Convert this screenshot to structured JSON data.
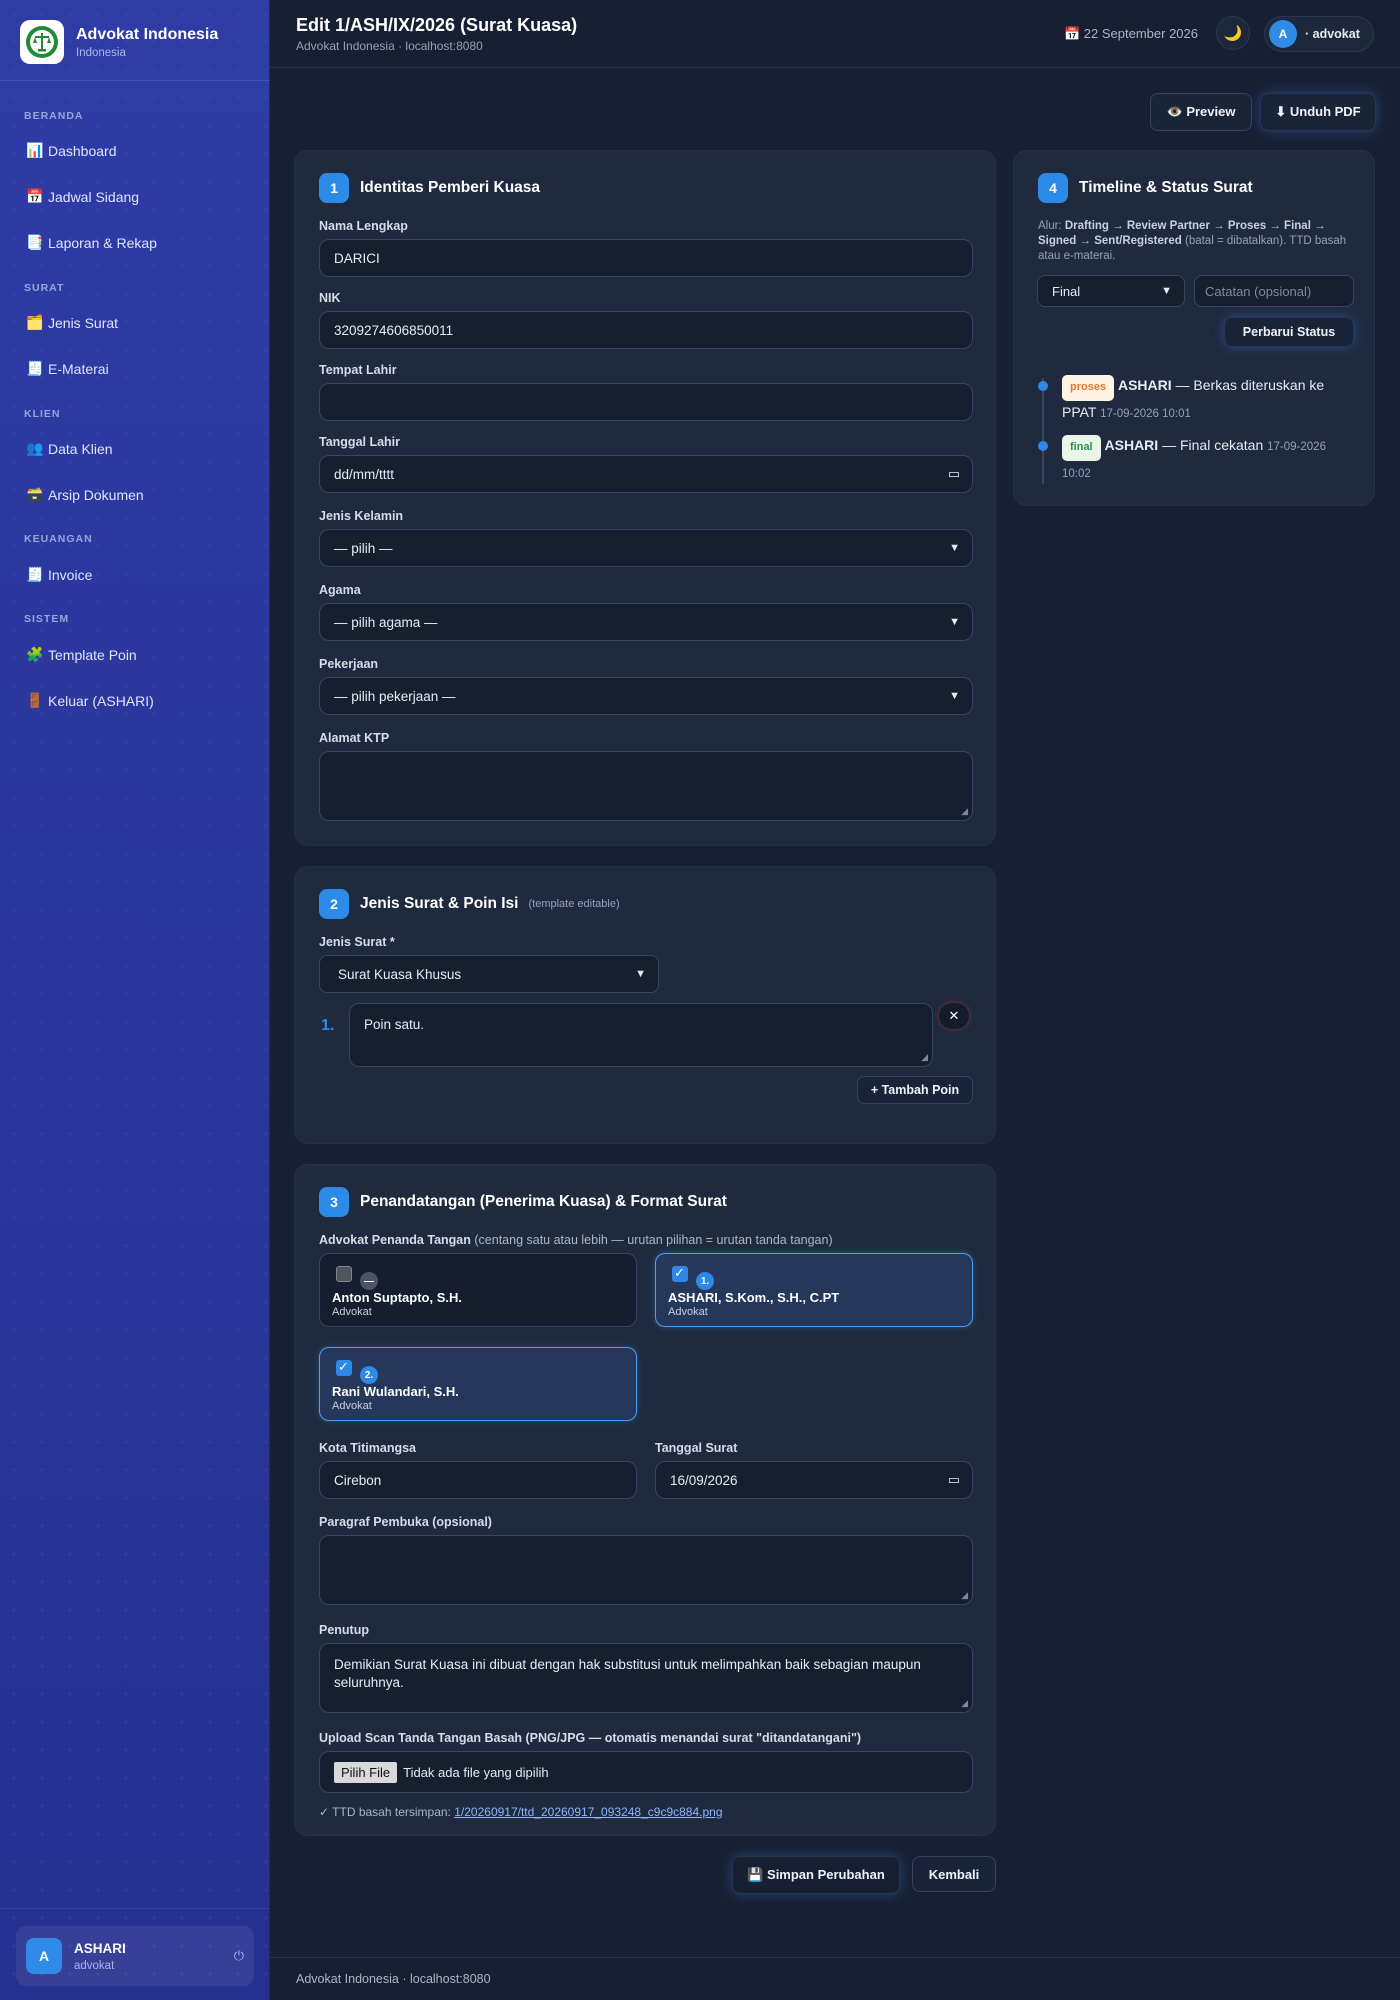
{
  "brand": {
    "name": "Advokat Indonesia",
    "subtitle": "Indonesia",
    "logo_icon": "scales-emblem-icon"
  },
  "sidebar": {
    "sections": [
      {
        "title": "BERANDA",
        "items": [
          {
            "icon": "📊",
            "label": "Dashboard"
          },
          {
            "icon": "📅",
            "label": "Jadwal Sidang"
          },
          {
            "icon": "📑",
            "label": "Laporan & Rekap"
          }
        ]
      },
      {
        "title": "SURAT",
        "items": [
          {
            "icon": "🗂️",
            "label": "Jenis Surat"
          },
          {
            "icon": "🧾",
            "label": "E-Materai"
          }
        ]
      },
      {
        "title": "KLIEN",
        "items": [
          {
            "icon": "👥",
            "label": "Data Klien"
          },
          {
            "icon": "🗃️",
            "label": "Arsip Dokumen"
          }
        ]
      },
      {
        "title": "KEUANGAN",
        "items": [
          {
            "icon": "🧾",
            "label": "Invoice"
          }
        ]
      },
      {
        "title": "SISTEM",
        "items": [
          {
            "icon": "🧩",
            "label": "Template Poin"
          },
          {
            "icon": "🚪",
            "label": "Keluar (ASHARI)"
          }
        ]
      }
    ],
    "user": {
      "initial": "A",
      "name": "ASHARI",
      "role": "advokat"
    }
  },
  "header": {
    "title": "Edit 1/ASH/IX/2026 (Surat Kuasa)",
    "subtitle": "Advokat Indonesia · localhost:8080",
    "date": "📅 22 September 2026",
    "theme_icon": "🌙",
    "user_initial": "A",
    "user_label": "· advokat"
  },
  "toolbar": {
    "preview": "👁️ Preview",
    "download": "⬇ Unduh PDF"
  },
  "section1": {
    "step": "1",
    "title": "Identitas Pemberi Kuasa",
    "fields": {
      "nama_label": "Nama Lengkap",
      "nama_value": "DARICI",
      "nik_label": "NIK",
      "nik_value": "3209274606850011",
      "tempat_label": "Tempat Lahir",
      "tempat_value": "",
      "tanggal_label": "Tanggal Lahir",
      "tanggal_value": "dd/mm/tttt",
      "kelamin_label": "Jenis Kelamin",
      "kelamin_value": "— pilih —",
      "agama_label": "Agama",
      "agama_value": "— pilih agama —",
      "pekerjaan_label": "Pekerjaan",
      "pekerjaan_value": "— pilih pekerjaan —",
      "alamat_label": "Alamat KTP",
      "alamat_value": ""
    }
  },
  "section2": {
    "step": "2",
    "title": "Jenis Surat & Poin Isi",
    "note": "(template editable)",
    "jenis_label": "Jenis Surat *",
    "jenis_value": "Surat Kuasa Khusus",
    "poin_number": "1.",
    "poin_value": "Poin satu.",
    "remove_icon": "✕",
    "add_label": "+ Tambah Poin"
  },
  "section3": {
    "step": "3",
    "title": "Penandatangan (Penerima Kuasa) & Format Surat",
    "signers_label": "Advokat Penanda Tangan",
    "signers_hint": "(centang satu atau lebih — urutan pilihan = urutan tanda tangan)",
    "signers": [
      {
        "name": "Anton Suptapto, S.H.",
        "role": "Advokat",
        "order": "—",
        "checked": false
      },
      {
        "name": "ASHARI, S.Kom., S.H., C.PT",
        "role": "Advokat",
        "order": "1.",
        "checked": true
      },
      {
        "name": "Rani Wulandari, S.H.",
        "role": "Advokat",
        "order": "2.",
        "checked": true
      }
    ],
    "kota_label": "Kota Titimangsa",
    "kota_value": "Cirebon",
    "tanggal_label": "Tanggal Surat",
    "tanggal_value": "16/09/2026",
    "pembuka_label": "Paragraf Pembuka (opsional)",
    "pembuka_value": "",
    "penutup_label": "Penutup",
    "penutup_value": "Demikian Surat Kuasa ini dibuat dengan hak substitusi untuk melimpahkan baik sebagian maupun seluruhnya.",
    "upload_label": "Upload Scan Tanda Tangan Basah (PNG/JPG — otomatis menandai surat \"ditandatangani\")",
    "upload_button": "Pilih File",
    "upload_status": "Tidak ada file yang dipilih",
    "saved_prefix": "✓ TTD basah tersimpan:",
    "saved_link": "1/20260917/ttd_20260917_093248_c9c9c884.png"
  },
  "actions": {
    "save": "💾 Simpan Perubahan",
    "back": "Kembali"
  },
  "section4": {
    "step": "4",
    "title": "Timeline & Status Surat",
    "flow_prefix": "Alur:",
    "flow_steps": "Drafting → Review Partner → Proses → Final → Signed → Sent/Registered",
    "flow_suffix": "(batal = dibatalkan). TTD basah atau e-materai.",
    "status_value": "Final",
    "note_placeholder": "Catatan (opsional)",
    "update_button": "Perbarui Status",
    "events": [
      {
        "badge": "proses",
        "actor": "ASHARI",
        "text": "— Berkas diteruskan ke PPAT",
        "time": "17-09-2026 10:01"
      },
      {
        "badge": "final",
        "actor": "ASHARI",
        "text": "— Final cekatan",
        "time": "17-09-2026 10:02"
      }
    ]
  },
  "footer": {
    "text": "Advokat Indonesia · localhost:8080"
  },
  "colors": {
    "accent": "#2d8be8",
    "sidebar": "#25308f",
    "background": "#172033",
    "card": "#1f2a3e"
  }
}
